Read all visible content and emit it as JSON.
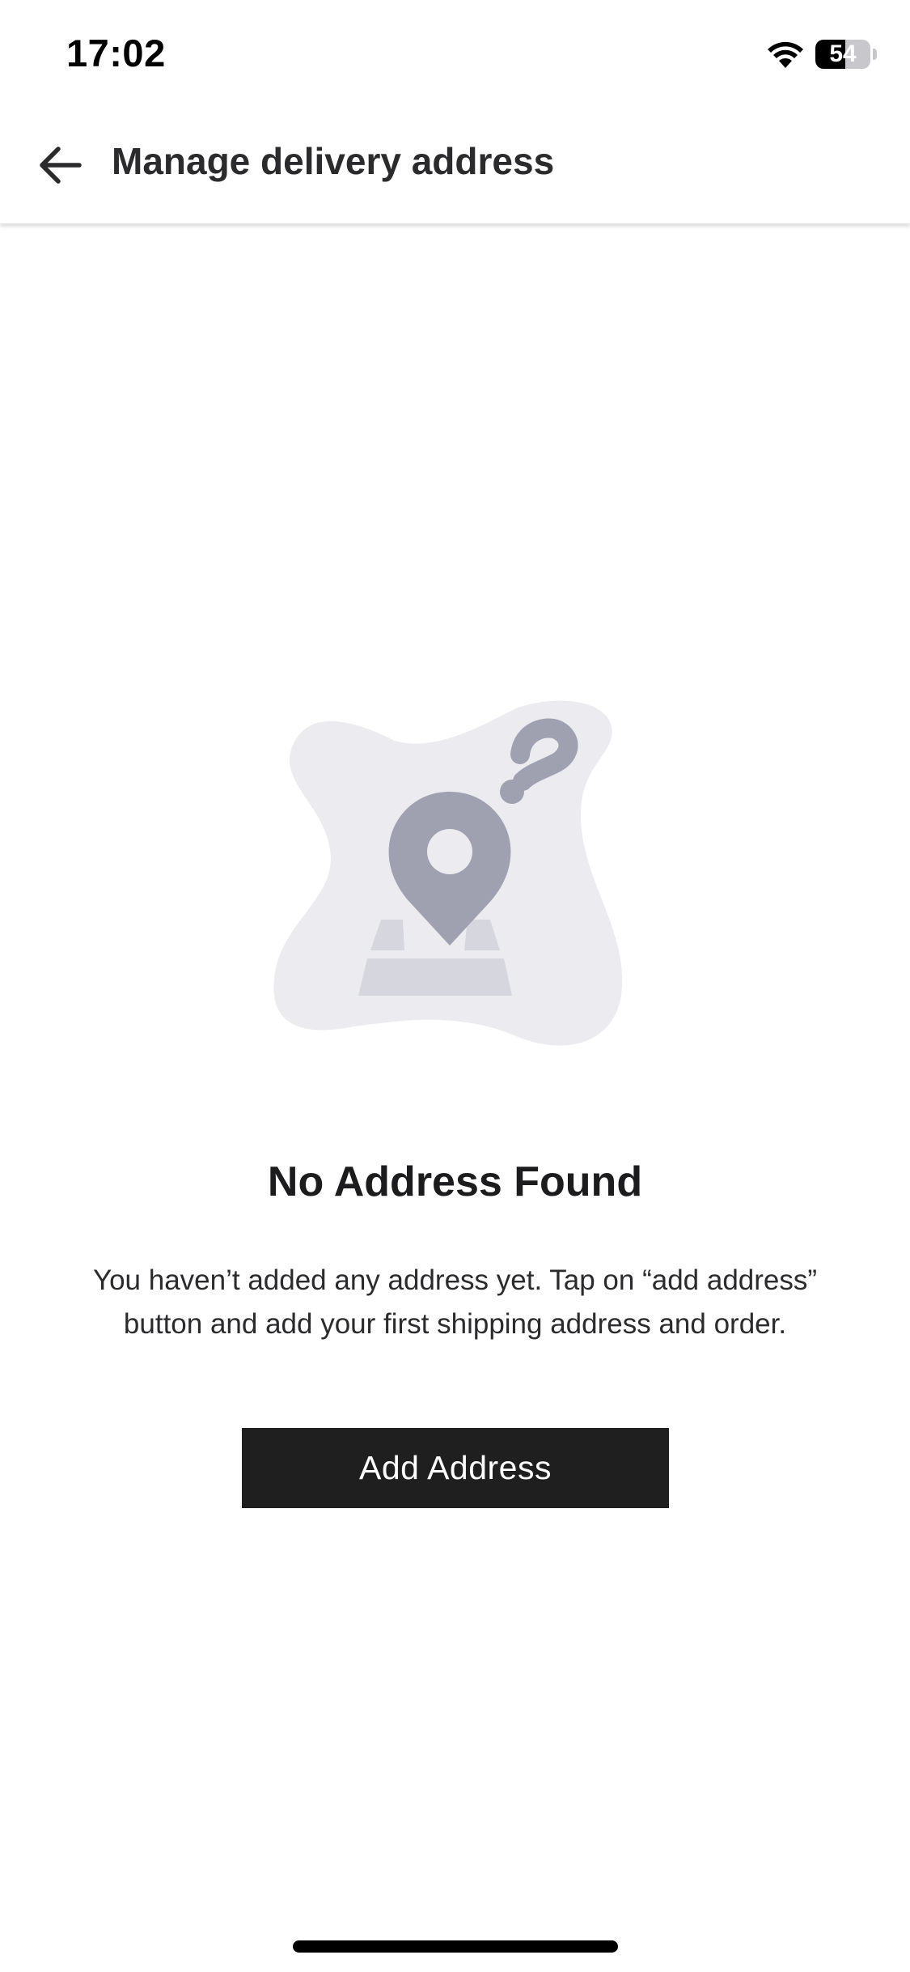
{
  "status_bar": {
    "time": "17:02",
    "battery_level": "54",
    "battery_fraction": 0.54,
    "icons": [
      "wifi-icon",
      "battery-icon"
    ]
  },
  "header": {
    "back_icon": "arrow-left-icon",
    "title": "Manage delivery address"
  },
  "empty_state": {
    "illustration_icon": "location-pin-question-icon",
    "title": "No Address Found",
    "message": "You haven’t added any address yet. Tap on “add address” button and add your first shipping address and order."
  },
  "actions": {
    "add_address_label": "Add Address"
  },
  "colors": {
    "button_bg": "#1f1f1f",
    "illustration_blob": "#ececf0",
    "illustration_pin": "#9fa1b0",
    "illustration_map": "#d6d7de"
  }
}
